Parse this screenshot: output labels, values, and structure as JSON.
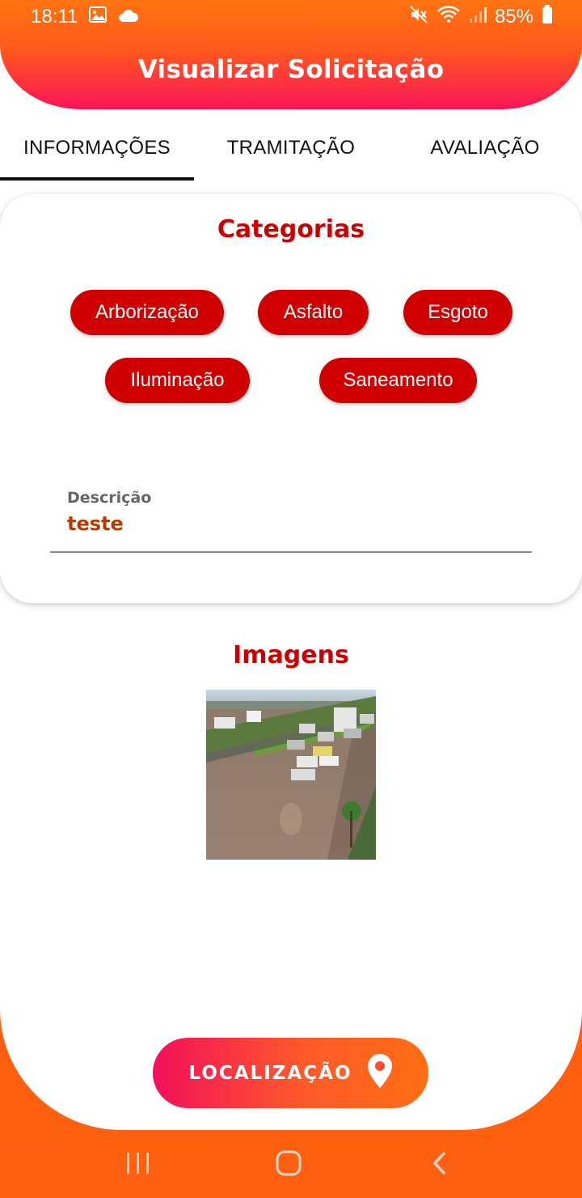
{
  "status_bar": {
    "time": "18:11",
    "battery": "85%",
    "icons": [
      "image-icon",
      "cloud-icon",
      "mute-icon",
      "wifi-icon",
      "signal-icon",
      "battery-icon"
    ]
  },
  "header": {
    "title": "Visualizar Solicitação"
  },
  "tabs": [
    {
      "label": "INFORMAÇÕES",
      "active": true
    },
    {
      "label": "TRAMITAÇÃO",
      "active": false
    },
    {
      "label": "AVALIAÇÃO",
      "active": false
    }
  ],
  "categories": {
    "title": "Categorias",
    "items": [
      {
        "label": "Arborização"
      },
      {
        "label": "Asfalto"
      },
      {
        "label": "Esgoto"
      },
      {
        "label": "Iluminação"
      },
      {
        "label": "Saneamento"
      }
    ]
  },
  "description": {
    "label": "Descrição",
    "value": "teste"
  },
  "images": {
    "title": "Imagens"
  },
  "location_button": {
    "label": "LOCALIZAÇÃO",
    "icon": "map-pin-icon"
  },
  "nav_bar": {
    "icons": [
      "recent-apps-icon",
      "home-icon",
      "back-icon"
    ]
  },
  "colors": {
    "accent_red": "#d10000",
    "header_orange": "#ff7410",
    "header_pink": "#f91458",
    "description_value": "#b83a00"
  }
}
